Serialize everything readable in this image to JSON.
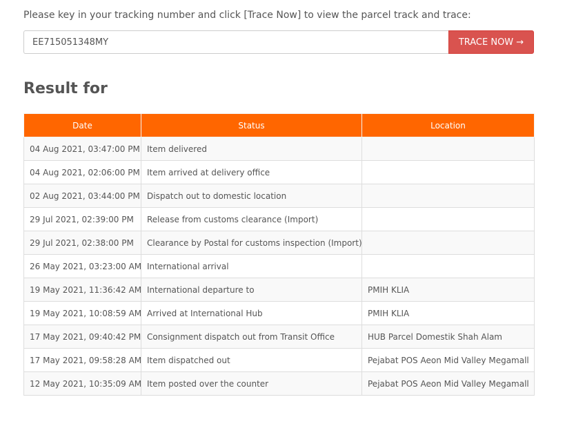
{
  "instruction": "Please key in your tracking number and click [Trace Now] to view the parcel track and trace:",
  "tracking": {
    "value": "EE715051348MY",
    "button_label": "TRACE NOW →"
  },
  "result_heading": "Result for",
  "table": {
    "headers": {
      "date": "Date",
      "status": "Status",
      "location": "Location"
    },
    "rows": [
      {
        "date": "04 Aug 2021, 03:47:00 PM",
        "status": "Item delivered",
        "location": ""
      },
      {
        "date": "04 Aug 2021, 02:06:00 PM",
        "status": "Item arrived at delivery office",
        "location": ""
      },
      {
        "date": "02 Aug 2021, 03:44:00 PM",
        "status": "Dispatch out to domestic location",
        "location": ""
      },
      {
        "date": "29 Jul 2021, 02:39:00 PM",
        "status": "Release from customs clearance (Import)",
        "location": ""
      },
      {
        "date": "29 Jul 2021, 02:38:00 PM",
        "status": "Clearance by Postal for customs inspection (Import)",
        "location": ""
      },
      {
        "date": "26 May 2021, 03:23:00 AM",
        "status": "International arrival",
        "location": ""
      },
      {
        "date": "19 May 2021, 11:36:42 AM",
        "status": "International departure to",
        "location": "PMIH KLIA"
      },
      {
        "date": "19 May 2021, 10:08:59 AM",
        "status": "Arrived at International Hub",
        "location": "PMIH KLIA"
      },
      {
        "date": "17 May 2021, 09:40:42 PM",
        "status": "Consignment dispatch out from Transit Office",
        "location": "HUB Parcel Domestik Shah Alam"
      },
      {
        "date": "17 May 2021, 09:58:28 AM",
        "status": "Item dispatched out",
        "location": "Pejabat POS Aeon Mid Valley Megamall"
      },
      {
        "date": "12 May 2021, 10:35:09 AM",
        "status": "Item posted over the counter",
        "location": "Pejabat POS Aeon Mid Valley Megamall"
      }
    ]
  },
  "colors": {
    "header_bg": "#ff6600",
    "button_bg": "#d9534f"
  }
}
